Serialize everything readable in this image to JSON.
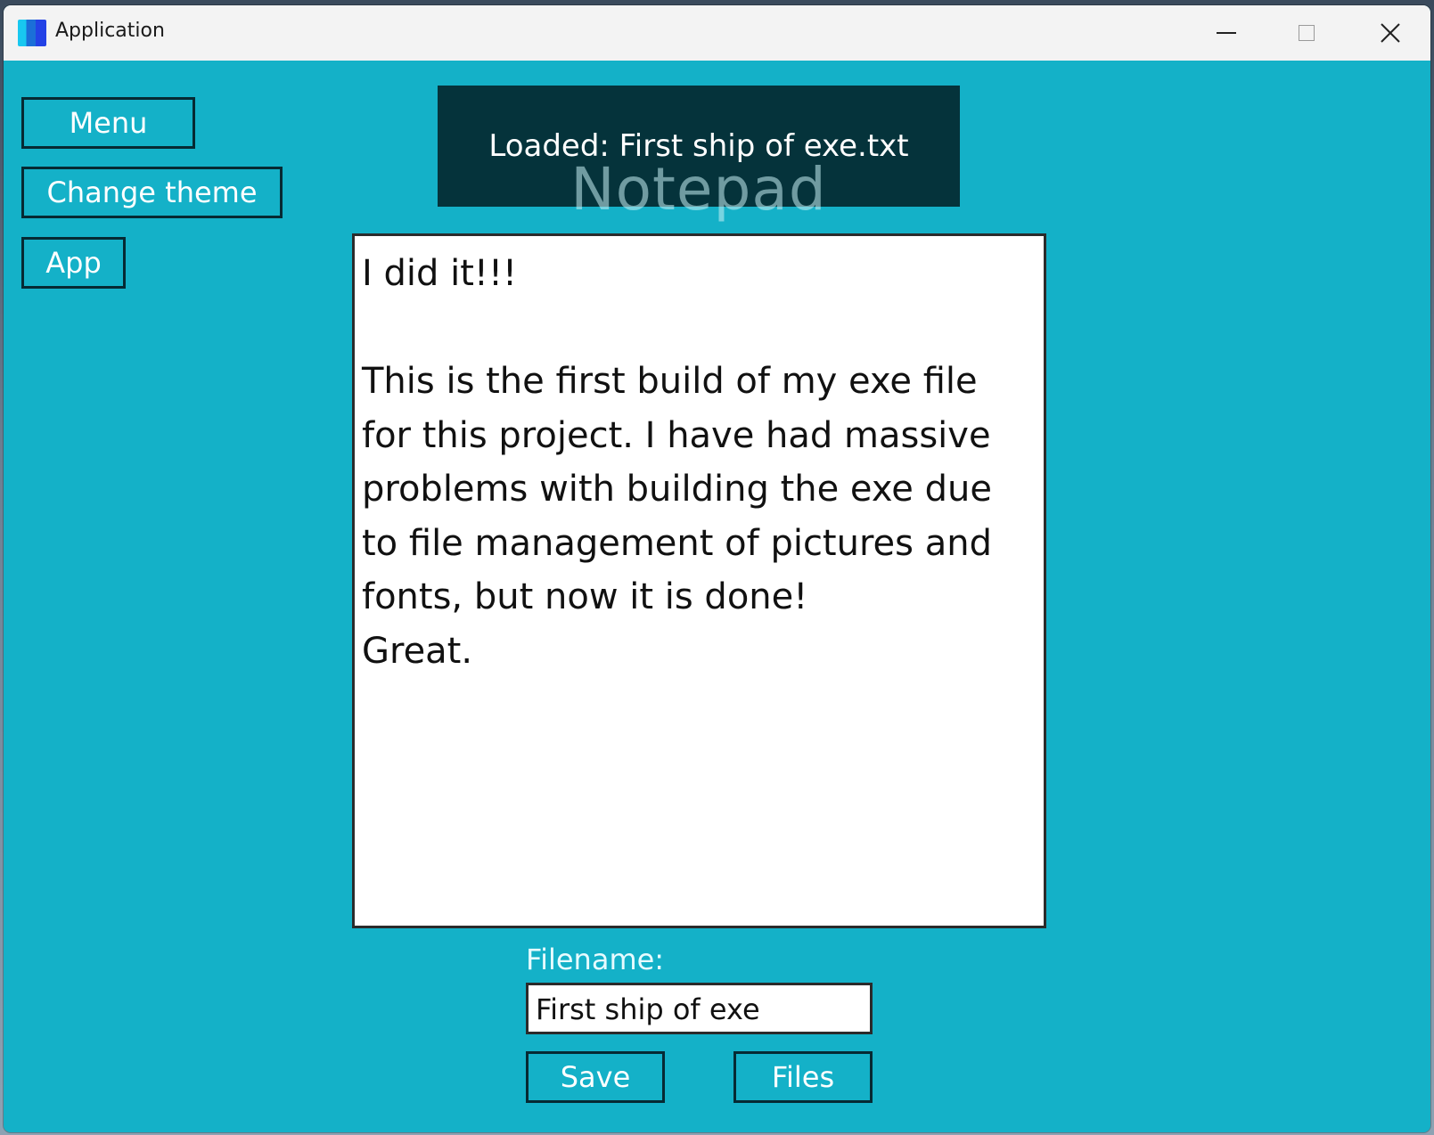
{
  "window": {
    "title": "Application"
  },
  "sidebar": {
    "menu_label": "Menu",
    "theme_label": "Change theme",
    "app_label": "App"
  },
  "notification": {
    "text": "Loaded: First ship of exe.txt"
  },
  "main": {
    "heading": "Notepad",
    "editor_text": "I did it!!!\n\nThis is the first build of my exe file for this project. I have had massive problems with building the exe due to file management of pictures and fonts, but now it is done!\nGreat.",
    "filename_label": "Filename:",
    "filename_value": "First ship of exe",
    "save_label": "Save",
    "files_label": "Files"
  },
  "colors": {
    "background": "#14b1c8",
    "button_border": "#062a33",
    "toast_background": "#042c34"
  }
}
